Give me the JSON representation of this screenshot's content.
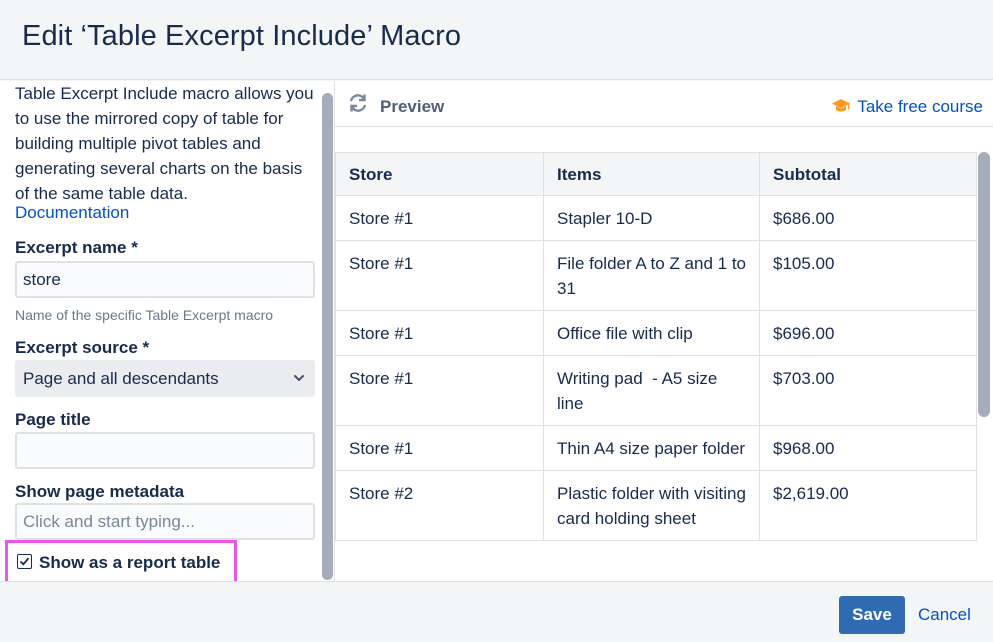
{
  "dialog": {
    "title": "Edit ‘Table Excerpt Include’ Macro"
  },
  "left": {
    "description": "Table Excerpt Include macro allows you to use the mirrored copy of table for building multiple pivot tables and generating several charts on the basis of the same table data.",
    "documentation_link": "Documentation",
    "excerpt_name": {
      "label": "Excerpt name *",
      "value": "store",
      "help": "Name of the specific Table Excerpt macro"
    },
    "excerpt_source": {
      "label": "Excerpt source *",
      "selected": "Page and all descendants"
    },
    "page_title": {
      "label": "Page title",
      "value": ""
    },
    "page_metadata": {
      "label": "Show page metadata",
      "placeholder": "Click and start typing..."
    },
    "report_table": {
      "label": "Show as a report table",
      "checked": true,
      "highlight_color": "#ee55ee"
    }
  },
  "preview": {
    "label": "Preview",
    "course_link": "Take free course",
    "icons": [
      "refresh-icon",
      "graduation-cap-icon"
    ],
    "table": {
      "headers": [
        "Store",
        "Items",
        "Subtotal"
      ],
      "rows": [
        [
          "Store #1",
          "Stapler 10-D",
          "$686.00"
        ],
        [
          "Store #1",
          "File folder A to Z and 1 to 31",
          "$105.00"
        ],
        [
          "Store #1",
          "Office file with clip",
          "$696.00"
        ],
        [
          "Store #1",
          "Writing pad  - A5 size line",
          "$703.00"
        ],
        [
          "Store #1",
          "Thin A4 size paper folder",
          "$968.00"
        ],
        [
          "Store #2",
          "Plastic folder with visiting card holding sheet",
          "$2,619.00"
        ]
      ]
    }
  },
  "footer": {
    "save_label": "Save",
    "cancel_label": "Cancel",
    "save_color": "#2f6bb3"
  }
}
